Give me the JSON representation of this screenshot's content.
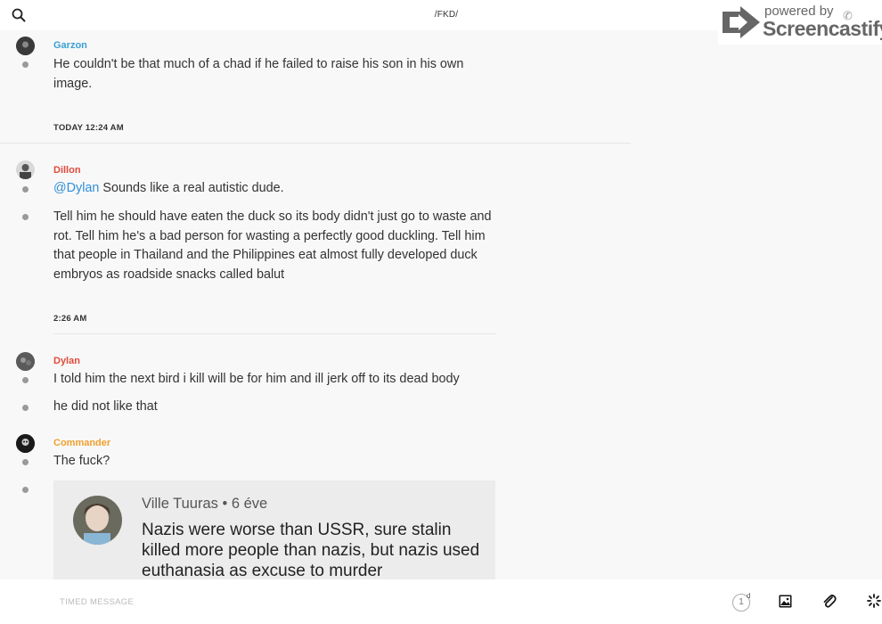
{
  "header": {
    "title": "/FKD/",
    "search_icon": "search-icon"
  },
  "watermark": {
    "powered": "powered by",
    "brand": "Screencastify",
    "phone_icon": "phone-icon"
  },
  "messages": [
    {
      "author": "Garzon",
      "author_color": "#3aa0d4",
      "lines": [
        "He couldn't be that much of a chad if he failed to raise his son in his own image."
      ]
    },
    {
      "author": "Dillon",
      "author_color": "#e04b3c",
      "mention": "@Dylan",
      "lines": [
        "Sounds like a real autistic dude.",
        "Tell him he should have eaten the duck so its body didn't just go to waste and rot. Tell him he's a bad person for wasting a perfectly good duckling. Tell him that people in Thailand and the Philippines eat almost fully developed duck embryos as roadside snacks called balut"
      ]
    },
    {
      "author": "Dylan",
      "author_color": "#e04b3c",
      "lines": [
        "I told him the next bird i kill will be for him and ill jerk off to its dead body",
        "he did not like that"
      ]
    },
    {
      "author": "Commander",
      "author_color": "#f0a030",
      "lines": [
        "The fuck?"
      ]
    }
  ],
  "timestamps": {
    "first": "TODAY 12:24 AM",
    "second": "2:26 AM"
  },
  "embed": {
    "author": "Ville Tuuras • 6 éve",
    "text": "Nazis were worse than USSR, sure stalin killed more people than nazis, but nazis used euthanasia as excuse to murder"
  },
  "composer": {
    "placeholder": "TIMED MESSAGE",
    "timer_count": "1",
    "timer_unit": "d"
  },
  "icons": [
    "timer-icon",
    "image-icon",
    "paperclip-icon",
    "loading-icon"
  ]
}
